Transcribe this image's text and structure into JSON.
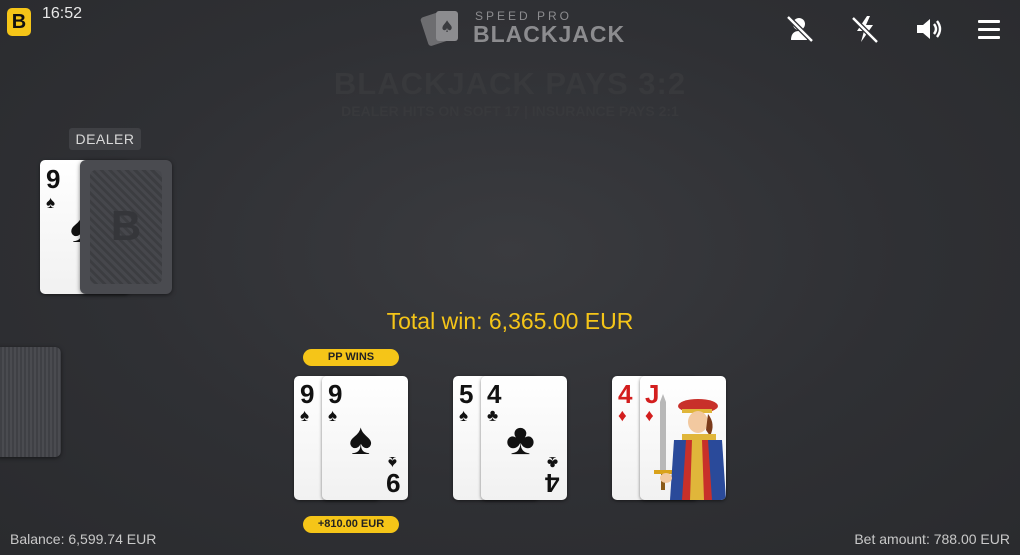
{
  "header": {
    "brand_letter": "B",
    "time": "16:52",
    "logo_top": "SPEED PRO",
    "logo_main": "BLACKJACK",
    "icons": [
      "no-video-icon",
      "no-flash-icon",
      "volume-icon",
      "menu-icon"
    ]
  },
  "table": {
    "pays_text": "BLACKJACK PAYS 3:2",
    "rules_text": "DEALER HITS ON SOFT 17 | INSURANCE PAYS 2:1"
  },
  "dealer": {
    "label": "DEALER",
    "up_card": {
      "rank": "9",
      "suit": "♠"
    },
    "hole_card_letter": "B"
  },
  "result": {
    "total_win": "Total win: 6,365.00 EUR"
  },
  "hands": [
    {
      "badge_top": "PP WINS",
      "badge_bottom": "+810.00 EUR",
      "cards": [
        {
          "rank": "9",
          "suit": "♠"
        },
        {
          "rank": "9",
          "suit": "♠"
        }
      ]
    },
    {
      "cards": [
        {
          "rank": "5",
          "suit": "♠"
        },
        {
          "rank": "4",
          "suit": "♣"
        }
      ]
    },
    {
      "cards": [
        {
          "rank": "4",
          "suit": "♦"
        },
        {
          "rank": "J",
          "suit": "♦"
        }
      ]
    }
  ],
  "footer": {
    "balance": "Balance: 6,599.74 EUR",
    "bet_amount": "Bet amount: 788.00 EUR"
  },
  "colors": {
    "accent": "#f5c518",
    "table": "#2f3034",
    "red_suit": "#d31e1e"
  }
}
